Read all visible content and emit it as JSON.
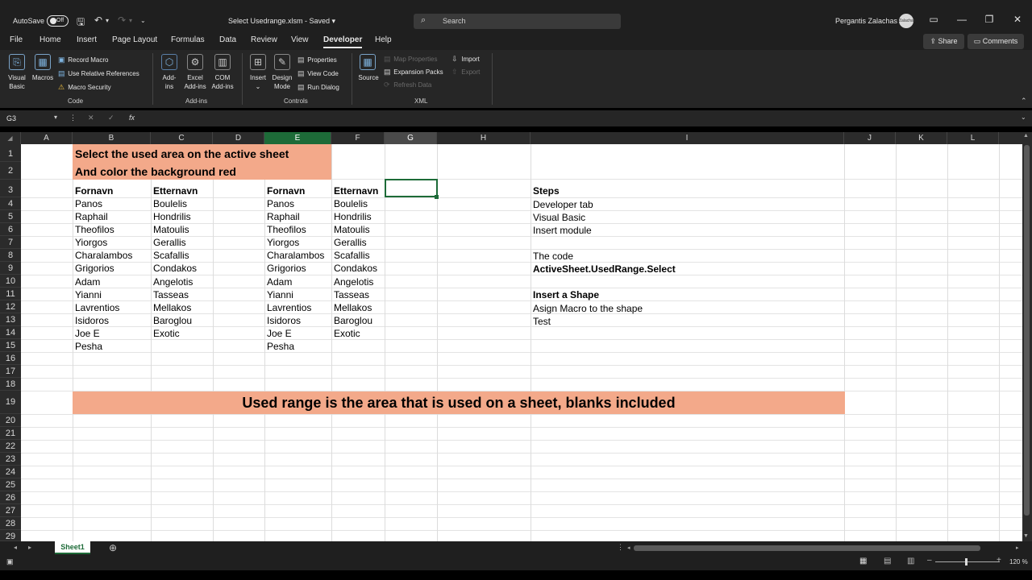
{
  "titlebar": {
    "autosave_label": "AutoSave",
    "autosave_state": "Off",
    "document_title": "Select Usedrange.xlsm - Saved ▾",
    "search_placeholder": "Search",
    "user_name": "Pergantis Zalachas",
    "avatar_text": "Zalachas"
  },
  "menu": {
    "tabs": [
      "File",
      "Home",
      "Insert",
      "Page Layout",
      "Formulas",
      "Data",
      "Review",
      "View",
      "Developer",
      "Help"
    ],
    "active_tab": "Developer",
    "share_label": "Share",
    "comments_label": "Comments"
  },
  "ribbon": {
    "code": {
      "group_label": "Code",
      "visual_basic": [
        "Visual",
        "Basic"
      ],
      "macros": "Macros",
      "record_macro": "Record Macro",
      "use_relative_references": "Use Relative References",
      "macro_security": "Macro Security"
    },
    "addins": {
      "group_label": "Add-ins",
      "addins": [
        "Add-",
        "ins"
      ],
      "excel_addins": [
        "Excel",
        "Add-ins"
      ],
      "com_addins": [
        "COM",
        "Add-ins"
      ]
    },
    "controls": {
      "group_label": "Controls",
      "insert": "Insert",
      "design_mode": [
        "Design",
        "Mode"
      ],
      "properties": "Properties",
      "view_code": "View Code",
      "run_dialog": "Run Dialog"
    },
    "xml": {
      "group_label": "XML",
      "source": "Source",
      "map_properties": "Map Properties",
      "expansion_packs": "Expansion Packs",
      "refresh_data": "Refresh Data",
      "import": "Import",
      "export": "Export"
    }
  },
  "formula_bar": {
    "name_box": "G3",
    "fx": "fx",
    "formula": ""
  },
  "grid": {
    "columns": [
      "A",
      "B",
      "C",
      "D",
      "E",
      "F",
      "G",
      "H",
      "I",
      "J",
      "K",
      "L"
    ],
    "selected_column": "E",
    "active_column": "G",
    "rows": [
      "1",
      "2",
      "3",
      "4",
      "5",
      "6",
      "7",
      "8",
      "9",
      "10",
      "11",
      "12",
      "13",
      "14",
      "15",
      "16",
      "17",
      "18",
      "19",
      "20",
      "21",
      "22",
      "23",
      "24",
      "25",
      "26",
      "27",
      "28",
      "29"
    ],
    "title_line1": "Select the used area on the active sheet",
    "title_line2": "And color the background red",
    "left_table": {
      "headers": [
        "Fornavn",
        "Etternavn"
      ],
      "rows": [
        [
          "Panos",
          "Boulelis"
        ],
        [
          "Raphail",
          "Hondrilis"
        ],
        [
          "Theofilos",
          "Matoulis"
        ],
        [
          "Yiorgos",
          "Gerallis"
        ],
        [
          "Charalambos",
          "Scafallis"
        ],
        [
          "Grigorios",
          "Condakos"
        ],
        [
          "Adam",
          "Angelotis"
        ],
        [
          "Yianni",
          "Tasseas"
        ],
        [
          "Lavrentios",
          "Mellakos"
        ],
        [
          "Isidoros",
          "Baroglou"
        ],
        [
          "Joe E",
          "Exotic"
        ],
        [
          "Pesha",
          ""
        ]
      ]
    },
    "right_table": {
      "headers": [
        "Fornavn",
        "Etternavn"
      ],
      "rows": [
        [
          "Panos",
          "Boulelis"
        ],
        [
          "Raphail",
          "Hondrilis"
        ],
        [
          "Theofilos",
          "Matoulis"
        ],
        [
          "Yiorgos",
          "Gerallis"
        ],
        [
          "Charalambos",
          "Scafallis"
        ],
        [
          "Grigorios",
          "Condakos"
        ],
        [
          "Adam",
          "Angelotis"
        ],
        [
          "Yianni",
          "Tasseas"
        ],
        [
          "Lavrentios",
          "Mellakos"
        ],
        [
          "Isidoros",
          "Baroglou"
        ],
        [
          "Joe E",
          "Exotic"
        ],
        [
          "Pesha",
          ""
        ]
      ]
    },
    "notes": {
      "steps_heading": "Steps",
      "step1": "Developer tab",
      "step2": "Visual Basic",
      "step3": "Insert module",
      "code_label": "The code",
      "code": "ActiveSheet.UsedRange.Select",
      "shape_heading": "Insert a Shape",
      "shape_step1": "Asign Macro to the shape",
      "shape_step2": "Test"
    },
    "banner": "Used range is the area that is used on a sheet, blanks included",
    "fill_color": "#f3a98a",
    "accent_color": "#1d6b38"
  },
  "sheet_tabs": {
    "tabs": [
      "Sheet1"
    ],
    "add_icon": "plus-circle-icon"
  },
  "statusbar": {
    "zoom": "120 %"
  }
}
